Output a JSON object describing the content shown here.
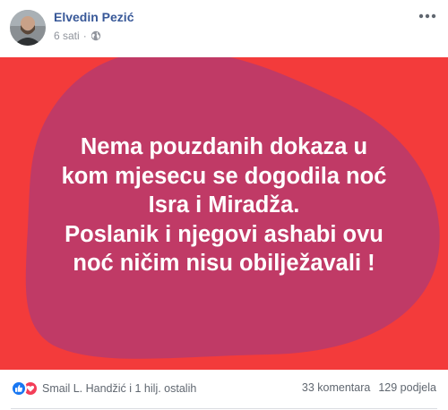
{
  "post": {
    "author": "Elvedin Pezić",
    "time": "6 sati",
    "separator": "·",
    "privacy_icon": "globe-icon",
    "more_icon": "more-options-icon"
  },
  "card": {
    "background": "#f33b3b",
    "blob_color": "#c03a66",
    "lines": [
      "Nema pouzdanih dokaza u",
      "kom mjesecu se dogodila noć",
      "Isra i Miradža.",
      "Poslanik i njegovi ashabi ovu",
      "noć ničim nisu obilježavali !"
    ]
  },
  "footer": {
    "reaction_icons": [
      "like-icon",
      "love-icon"
    ],
    "reactors": "Smail L. Handžić i 1 hilj. ostalih",
    "comments": "33 komentara",
    "shares": "129 podjela"
  }
}
